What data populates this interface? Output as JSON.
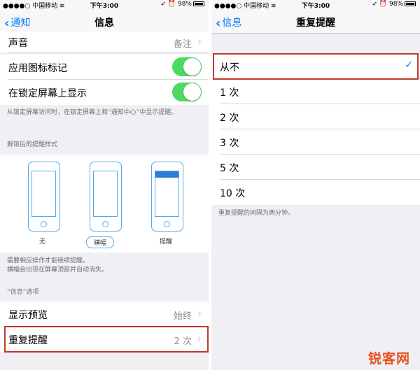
{
  "status": {
    "carrier": "●●●●○ 中国移动",
    "wifi": "≋",
    "time": "下午3:00",
    "right": "➶ ⏰ 98%"
  },
  "left": {
    "back_label": "通知",
    "title": "信息",
    "sound_label": "声音",
    "sound_value": "备注",
    "badge_label": "应用图标标记",
    "lockscreen_label": "在锁定屏幕上显示",
    "lockscreen_footer": "从锁定屏幕访问时，在锁定屏幕上和“通知中心”中显示提醒。",
    "alert_style_header": "解锁后的提醒样式",
    "styles": [
      {
        "label": "无"
      },
      {
        "label": "横幅"
      },
      {
        "label": "提醒"
      }
    ],
    "alert_style_footer_1": "需要相应操作才能继续提醒。",
    "alert_style_footer_2": "横幅会出现在屏幕顶部并自动消失。",
    "options_header": "“信息”选项",
    "preview_label": "显示预览",
    "preview_value": "始终",
    "repeat_label": "重复提醒",
    "repeat_value": "2 次"
  },
  "right": {
    "back_label": "信息",
    "title": "重复提醒",
    "options": [
      "从不",
      "1 次",
      "2 次",
      "3 次",
      "5 次",
      "10 次"
    ],
    "footer": "重复提醒的间隔为两分钟。"
  },
  "watermark": "锐客网",
  "colors": {
    "accent": "#007aff",
    "toggle_on": "#4cd964",
    "highlight": "#c0392b",
    "watermark": "#e8511f"
  }
}
